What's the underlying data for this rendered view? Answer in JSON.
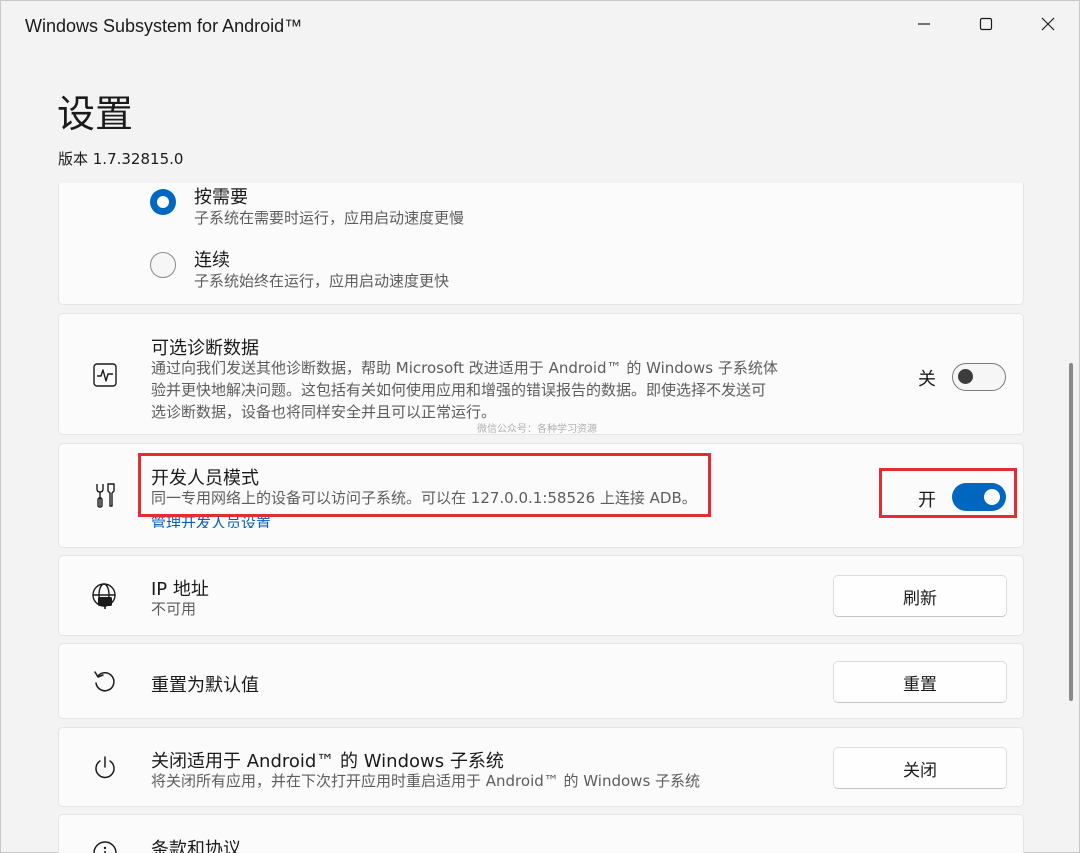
{
  "window": {
    "title": "Windows Subsystem for Android™"
  },
  "header": {
    "title": "设置",
    "version": "版本 1.7.32815.0"
  },
  "run_mode": {
    "options": [
      {
        "label": "按需要",
        "description": "子系统在需要时运行，应用启动速度更慢",
        "selected": true
      },
      {
        "label": "连续",
        "description": "子系统始终在运行，应用启动速度更快",
        "selected": false
      }
    ]
  },
  "diagnostics": {
    "title": "可选诊断数据",
    "description_lines": [
      "通过向我们发送其他诊断数据，帮助 Microsoft 改进适用于 Android™ 的 Windows 子系统体",
      "验并更快地解决问题。这包括有关如何使用应用和增强的错误报告的数据。即使选择不发送可",
      "选诊断数据，设备也将同样安全并且可以正常运行。"
    ],
    "toggle_label": "关",
    "toggle_on": false,
    "icon": "activity-monitor-icon"
  },
  "watermark": "微信公众号：各种学习资源",
  "developer_mode": {
    "title": "开发人员模式",
    "description": "同一专用网络上的设备可以访问子系统。可以在 127.0.0.1:58526 上连接 ADB。",
    "link": "管理开发人员设置",
    "toggle_label": "开",
    "toggle_on": true,
    "icon": "developer-tools-icon",
    "highlight_color": "#e32d35"
  },
  "ip_address": {
    "title": "IP 地址",
    "value": "不可用",
    "button": "刷新",
    "icon": "globe-network-icon"
  },
  "reset": {
    "title": "重置为默认值",
    "button": "重置",
    "icon": "reset-icon"
  },
  "shutdown": {
    "title": "关闭适用于 Android™ 的 Windows 子系统",
    "description": "将关闭所有应用，并在下次打开应用时重启适用于 Android™ 的 Windows 子系统",
    "button": "关闭",
    "icon": "power-icon"
  },
  "terms": {
    "title": "条款和协议",
    "icon": "info-icon"
  },
  "colors": {
    "accent": "#0067c0",
    "background": "#f3f3f3",
    "card": "#fbfbfb"
  }
}
